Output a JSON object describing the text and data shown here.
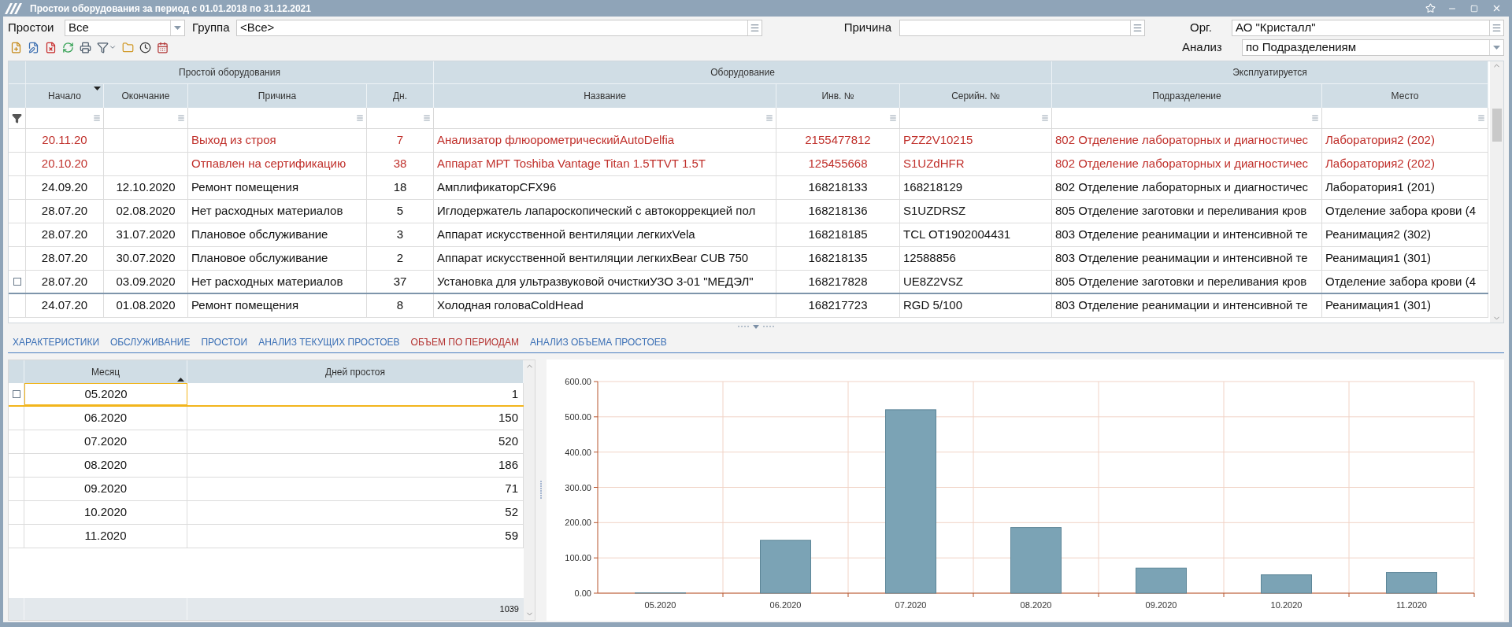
{
  "window": {
    "title": "Простои оборудования за период с 01.01.2018 по 31.12.2021"
  },
  "filters": {
    "downtime": {
      "label": "Простои",
      "value": "Все"
    },
    "group": {
      "label": "Группа",
      "value": "<Все>"
    },
    "reason": {
      "label": "Причина"
    },
    "org": {
      "label": "Орг.",
      "value": "АО \"Кристалл\""
    },
    "analysis": {
      "label": "Анализ",
      "value": "по Подразделениям"
    }
  },
  "grid": {
    "column_groups": [
      {
        "label": "Простой оборудования",
        "columns": [
          {
            "label": "Начало",
            "sorted": true,
            "descending": true
          },
          {
            "label": "Окончание",
            "sorted": false
          },
          {
            "label": "Причина",
            "sorted": false
          },
          {
            "label": "Дн.",
            "sorted": false
          }
        ]
      },
      {
        "label": "Оборудование",
        "columns": [
          {
            "label": "Название",
            "sorted": false
          },
          {
            "label": "Инв. №",
            "sorted": false
          },
          {
            "label": "Серийн. №",
            "sorted": false
          }
        ]
      },
      {
        "label": "Эксплуатируется",
        "columns": [
          {
            "label": "Подразделение",
            "sorted": false
          },
          {
            "label": "Место",
            "sorted": false
          }
        ]
      }
    ],
    "rows": [
      {
        "active": true,
        "selected": false,
        "cells": [
          "20.11.20",
          null,
          "Выход из строя",
          "7",
          "Анализатор флюорометрическийAutoDelfia",
          "2155477812",
          "PZZ2V10215",
          "802 Отделение лабораторных и диагностичес",
          "Лаборатория2 (202)"
        ]
      },
      {
        "active": true,
        "selected": false,
        "cells": [
          "20.10.20",
          null,
          "Отпавлен на сертификацию",
          "38",
          "Аппарат МРТ Toshiba Vantage Titan 1.5TTVT 1.5T",
          "125455668",
          "S1UZdHFR",
          "802 Отделение лабораторных и диагностичес",
          "Лаборатория2 (202)"
        ]
      },
      {
        "active": false,
        "selected": false,
        "cells": [
          "24.09.20",
          "12.10.2020",
          "Ремонт помещения",
          "18",
          "АмплификаторCFX96",
          "168218133",
          "168218129",
          "802 Отделение лабораторных и диагностичес",
          "Лаборатория1 (201)"
        ]
      },
      {
        "active": false,
        "selected": false,
        "cells": [
          "28.07.20",
          "02.08.2020",
          "Нет расходных материалов",
          "5",
          "Иглодержатель лапароскопический с автокоррекцией пол",
          "168218136",
          "S1UZDRSZ",
          "805 Отделение заготовки и переливания кров",
          "Отделение забора крови (4"
        ]
      },
      {
        "active": false,
        "selected": false,
        "cells": [
          "28.07.20",
          "31.07.2020",
          "Плановое обслуживание",
          "3",
          "Аппарат искусственной вентиляции легкихVela",
          "168218185",
          "TCL OT1902004431",
          "803 Отделение  реанимации и интенсивной те",
          "Реанимация2 (302)"
        ]
      },
      {
        "active": false,
        "selected": false,
        "cells": [
          "28.07.20",
          "30.07.2020",
          "Плановое обслуживание",
          "2",
          "Аппарат искусственной вентиляции легкихBear CUB 750",
          "168218135",
          "12588856",
          "803 Отделение  реанимации и интенсивной те",
          "Реанимация1 (301)"
        ]
      },
      {
        "active": false,
        "selected": true,
        "cells": [
          "28.07.20",
          "03.09.2020",
          "Нет расходных материалов",
          "37",
          "Установка для ультразвуковой очисткиУЗО 3-01 \"МЕДЭЛ\"",
          "168217828",
          "UE8Z2VSZ",
          "805 Отделение заготовки и переливания кров",
          "Отделение забора крови (4"
        ]
      },
      {
        "active": false,
        "selected": false,
        "cells": [
          "24.07.20",
          "01.08.2020",
          "Ремонт помещения",
          "8",
          "Холодная головаColdHead",
          "168217723",
          "RGD 5/100",
          "803 Отделение  реанимации и интенсивной те",
          "Реанимация1 (301)"
        ]
      }
    ]
  },
  "tabs": [
    {
      "label": "ХАРАКТЕРИСТИКИ",
      "selected": false
    },
    {
      "label": "ОБСЛУЖИВАНИЕ",
      "selected": false
    },
    {
      "label": "ПРОСТОИ",
      "selected": false
    },
    {
      "label": "АНАЛИЗ ТЕКУЩИХ ПРОСТОЕВ",
      "selected": false
    },
    {
      "label": "ОБЪЕМ ПО ПЕРИОДАМ",
      "selected": true
    },
    {
      "label": "АНАЛИЗ ОБЪЕМА ПРОСТОЕВ",
      "selected": false
    }
  ],
  "period_grid": {
    "columns": [
      {
        "label": "Месяц",
        "sorted": true,
        "descending": false
      },
      {
        "label": "Дней простоя",
        "sorted": false
      }
    ],
    "rows": [
      {
        "selected": true,
        "cells": [
          "05.2020",
          "1"
        ]
      },
      {
        "selected": false,
        "cells": [
          "06.2020",
          "150"
        ]
      },
      {
        "selected": false,
        "cells": [
          "07.2020",
          "520"
        ]
      },
      {
        "selected": false,
        "cells": [
          "08.2020",
          "186"
        ]
      },
      {
        "selected": false,
        "cells": [
          "09.2020",
          "71"
        ]
      },
      {
        "selected": false,
        "cells": [
          "10.2020",
          "52"
        ]
      },
      {
        "selected": false,
        "cells": [
          "11.2020",
          "59"
        ]
      }
    ],
    "total": "1039"
  },
  "chart": {
    "chart_data": {
      "type": "bar",
      "categories": [
        "05.2020",
        "06.2020",
        "07.2020",
        "08.2020",
        "09.2020",
        "10.2020",
        "11.2020"
      ],
      "values": [
        1,
        150,
        520,
        186,
        71,
        52,
        59
      ],
      "ylim": [
        0,
        600
      ],
      "grid": true,
      "yticks": [
        {
          "value": 0,
          "label": "0.00"
        },
        {
          "value": 100,
          "label": "100.00"
        },
        {
          "value": 200,
          "label": "200.00"
        },
        {
          "value": 300,
          "label": "300.00"
        },
        {
          "value": 400,
          "label": "400.00"
        },
        {
          "value": 500,
          "label": "500.00"
        },
        {
          "value": 600,
          "label": "600.00"
        }
      ]
    }
  }
}
